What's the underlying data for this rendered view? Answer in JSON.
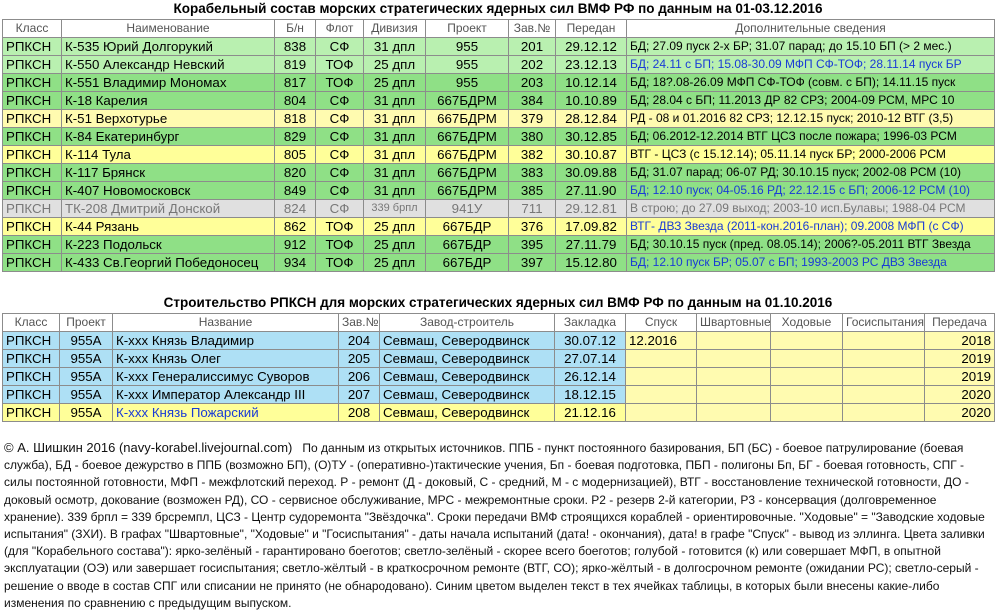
{
  "title1": "Корабельный состав морских стратегических ядерных сил ВМФ РФ по данным на 01-03.12.2016",
  "table1": {
    "headers": [
      "Класс",
      "Наименование",
      "Б/н",
      "Флот",
      "Дивизия",
      "Проект",
      "Зав.№",
      "Передан",
      "Дополнительные сведения"
    ],
    "colors": {
      "green": "#8fe086",
      "light_green": "#b9f0b0",
      "yellow": "#ffff99",
      "light_yellow": "#fffbb0",
      "grey": "#e0e0e0",
      "blue_text": "#1a3bd6"
    },
    "rows": [
      {
        "cls": "РПКСН",
        "name": "К-535 Юрий Долгорукий",
        "bn": "838",
        "fleet": "СФ",
        "div": "31 дпл",
        "proj": "955",
        "zav": "201",
        "date": "29.12.12",
        "info": "БД; 27.09 пуск 2-х БР; 31.07 парад; до 15.10 БП (> 2 мес.)",
        "bg": "#b9f0b0",
        "info_blue": false
      },
      {
        "cls": "РПКСН",
        "name": "К-550 Александр Невский",
        "bn": "819",
        "fleet": "ТОФ",
        "div": "25 дпл",
        "proj": "955",
        "zav": "202",
        "date": "23.12.13",
        "info": "БД; 24.11 с БП; 15.08-30.09 МФП СФ-ТОФ; 28.11.14 пуск БР",
        "bg": "#b9f0b0",
        "info_blue": true
      },
      {
        "cls": "РПКСН",
        "name": "К-551 Владимир Мономах",
        "bn": "817",
        "fleet": "ТОФ",
        "div": "25 дпл",
        "proj": "955",
        "zav": "203",
        "date": "10.12.14",
        "info": "БД; 18?.08-26.09 МФП СФ-ТОФ (совм. с БП); 14.11.15 пуск",
        "bg": "#8fe086",
        "info_blue": false
      },
      {
        "cls": "РПКСН",
        "name": "К-18   Карелия",
        "bn": "804",
        "fleet": "СФ",
        "div": "31 дпл",
        "proj": "667БДРМ",
        "zav": "384",
        "date": "10.10.89",
        "info": "БД; 28.04 с БП; 11.2013 ДР 82 СРЗ; 2004-09 РСМ, МРС 10",
        "bg": "#8fe086",
        "info_blue": false
      },
      {
        "cls": "РПКСН",
        "name": "К-51   Верхотурье",
        "bn": "818",
        "fleet": "СФ",
        "div": "31 дпл",
        "proj": "667БДРМ",
        "zav": "379",
        "date": "28.12.84",
        "info": "РД - 08 и 01.2016 82 СРЗ; 12.12.15 пуск; 2010-12 ВТГ (3,5)",
        "bg": "#fffbb0",
        "info_blue": false
      },
      {
        "cls": "РПКСН",
        "name": "К-84   Екатеринбург",
        "bn": "829",
        "fleet": "СФ",
        "div": "31 дпл",
        "proj": "667БДРМ",
        "zav": "380",
        "date": "30.12.85",
        "info": "БД; 06.2012-12.2014 ВТГ ЦСЗ после пожара; 1996-03 РСМ",
        "bg": "#8fe086",
        "info_blue": false
      },
      {
        "cls": "РПКСН",
        "name": "К-114 Тула",
        "bn": "805",
        "fleet": "СФ",
        "div": "31 дпл",
        "proj": "667БДРМ",
        "zav": "382",
        "date": "30.10.87",
        "info": "ВТГ - ЦСЗ (с 15.12.14); 05.11.14 пуск БР; 2000-2006 РСМ",
        "bg": "#ffff99",
        "info_blue": false
      },
      {
        "cls": "РПКСН",
        "name": "К-117 Брянск",
        "bn": "820",
        "fleet": "СФ",
        "div": "31 дпл",
        "proj": "667БДРМ",
        "zav": "383",
        "date": "30.09.88",
        "info": "БД; 31.07 парад; 06-07 РД; 30.10.15 пуск; 2002-08 РСМ (10)",
        "bg": "#8fe086",
        "info_blue": false
      },
      {
        "cls": "РПКСН",
        "name": "К-407 Новомосковск",
        "bn": "849",
        "fleet": "СФ",
        "div": "31 дпл",
        "proj": "667БДРМ",
        "zav": "385",
        "date": "27.11.90",
        "info": "БД; 12.10 пуск; 04-05.16 РД; 22.12.15 с БП; 2006-12 РСМ (10)",
        "bg": "#8fe086",
        "info_blue": true
      },
      {
        "cls": "РПКСН",
        "name": "ТК-208 Дмитрий Донской",
        "bn": "824",
        "fleet": "СФ",
        "div": "339 брпл",
        "proj": "941У",
        "zav": "711",
        "date": "29.12.81",
        "info": "В строю; до 27.09 выход; 2003-10 исп.Булавы; 1988-04 РСМ",
        "bg": "#e0e0e0",
        "info_blue": false,
        "grey": true
      },
      {
        "cls": "РПКСН",
        "name": "К-44   Рязань",
        "bn": "862",
        "fleet": "ТОФ",
        "div": "25 дпл",
        "proj": "667БДР",
        "zav": "376",
        "date": "17.09.82",
        "info": "ВТГ- ДВЗ Звезда (2011-кон.2016-план); 09.2008 МФП (с СФ)",
        "bg": "#ffff99",
        "info_blue": true
      },
      {
        "cls": "РПКСН",
        "name": "К-223 Подольск",
        "bn": "912",
        "fleet": "ТОФ",
        "div": "25 дпл",
        "proj": "667БДР",
        "zav": "395",
        "date": "27.11.79",
        "info": "БД; 30.10.15 пуск (пред. 08.05.14); 2006?-05.2011 ВТГ Звезда",
        "bg": "#8fe086",
        "info_blue": false
      },
      {
        "cls": "РПКСН",
        "name": "К-433 Св.Георгий Победоносец",
        "bn": "934",
        "fleet": "ТОФ",
        "div": "25 дпл",
        "proj": "667БДР",
        "zav": "397",
        "date": "15.12.80",
        "info": "БД; 12.10 пуск БР; 05.07 с БП; 1993-2003 РС ДВЗ Звезда",
        "bg": "#8fe086",
        "info_blue": true
      }
    ]
  },
  "title2": "Строительство РПКСН для морских стратегических ядерных сил ВМФ РФ по данным на 01.10.2016",
  "table2": {
    "headers": [
      "Класс",
      "Проект",
      "Название",
      "Зав.№",
      "Завод-строитель",
      "Закладка",
      "Спуск",
      "Швартовные",
      "Ходовые",
      "Госиспытания",
      "Передача"
    ],
    "rows": [
      {
        "cls": "РПКСН",
        "proj": "955А",
        "name": "К-ххх Князь Владимир",
        "zav": "204",
        "yard": "Севмаш, Северодвинск",
        "laid": "30.07.12",
        "launch": "12.2016",
        "moor": "",
        "sea": "",
        "state": "",
        "deliv": "2018",
        "bg": "#aee0f5",
        "name_blue": false
      },
      {
        "cls": "РПКСН",
        "proj": "955А",
        "name": "К-ххх Князь Олег",
        "zav": "205",
        "yard": "Севмаш, Северодвинск",
        "laid": "27.07.14",
        "launch": "",
        "moor": "",
        "sea": "",
        "state": "",
        "deliv": "2019",
        "bg": "#aee0f5",
        "name_blue": false
      },
      {
        "cls": "РПКСН",
        "proj": "955А",
        "name": "К-ххх Генералиссимус Суворов",
        "zav": "206",
        "yard": "Севмаш, Северодвинск",
        "laid": "26.12.14",
        "launch": "",
        "moor": "",
        "sea": "",
        "state": "",
        "deliv": "2019",
        "bg": "#aee0f5",
        "name_blue": false
      },
      {
        "cls": "РПКСН",
        "proj": "955А",
        "name": "К-ххх Император Александр III",
        "zav": "207",
        "yard": "Севмаш, Северодвинск",
        "laid": "18.12.15",
        "launch": "",
        "moor": "",
        "sea": "",
        "state": "",
        "deliv": "2020",
        "bg": "#aee0f5",
        "name_blue": false
      },
      {
        "cls": "РПКСН",
        "proj": "955А",
        "name": "К-ххх Князь Пожарский",
        "zav": "208",
        "yard": "Севмаш, Северодвинск",
        "laid": "21.12.16",
        "launch": "",
        "moor": "",
        "sea": "",
        "state": "",
        "deliv": "2020",
        "bg": "#ffff99",
        "name_blue": true
      }
    ],
    "empty_cell_bg": "#fffbb0"
  },
  "footer": {
    "copyright": "© А. Шишкин 2016 (navy-korabel.livejournal.com)",
    "text": "По данным из открытых источников. ППБ - пункт постоянного базирования, БП (БС) - боевое патрулирование (боевая служба), БД - боевое дежурство в ППБ (возможно БП), (О)ТУ - (оперативно-)тактические учения, Бп - боевая подготовка, ПБП - полигоны Бп, БГ - боевая готовность, СПГ - силы постоянной готовности, МФП - межфлотский переход. Р - ремонт (Д - доковый, С - средний, М - с модернизацией), ВТГ - восстановление технической готовности, ДО - доковый осмотр, докование (возможен РД), СО - сервисное обслуживание, МРС - межремонтные сроки. Р2 - резерв 2-й категории, Р3 - консервация (долговременное хранение). 339 брпл = 339 брсремпл, ЦСЗ - Центр судоремонта \"Звёздочка\". Сроки передачи ВМФ строящихся кораблей - ориентировочные. \"Ходовые\" = \"Заводские ходовые испытания\" (ЗХИ). В графах \"Швартовные\", \"Ходовые\" и \"Госиспытания\" - даты начала испытаний (дата! - окончания), дата! в графе \"Спуск\" - вывод из эллинга. Цвета заливки (для \"Корабельного состава\"): ярко-зелёный - гарантировано боеготов; светло-зелёный - скорее всего боеготов; голубой - готовится (к) или совершает МФП, в опытной эксплуатации (ОЭ) или завершает госиспытания; светло-жёлтый - в краткосрочном ремонте (ВТГ, СО); ярко-жёлтый - в долгосрочном ремонте (ожидании РС); светло-серый - решение о вводе в состав СПГ или списании не принято (не обнародовано). Синим цветом выделен текст в тех ячейках таблицы, в которых были внесены какие-либо изменения по сравнению с предыдущим выпуском."
  }
}
